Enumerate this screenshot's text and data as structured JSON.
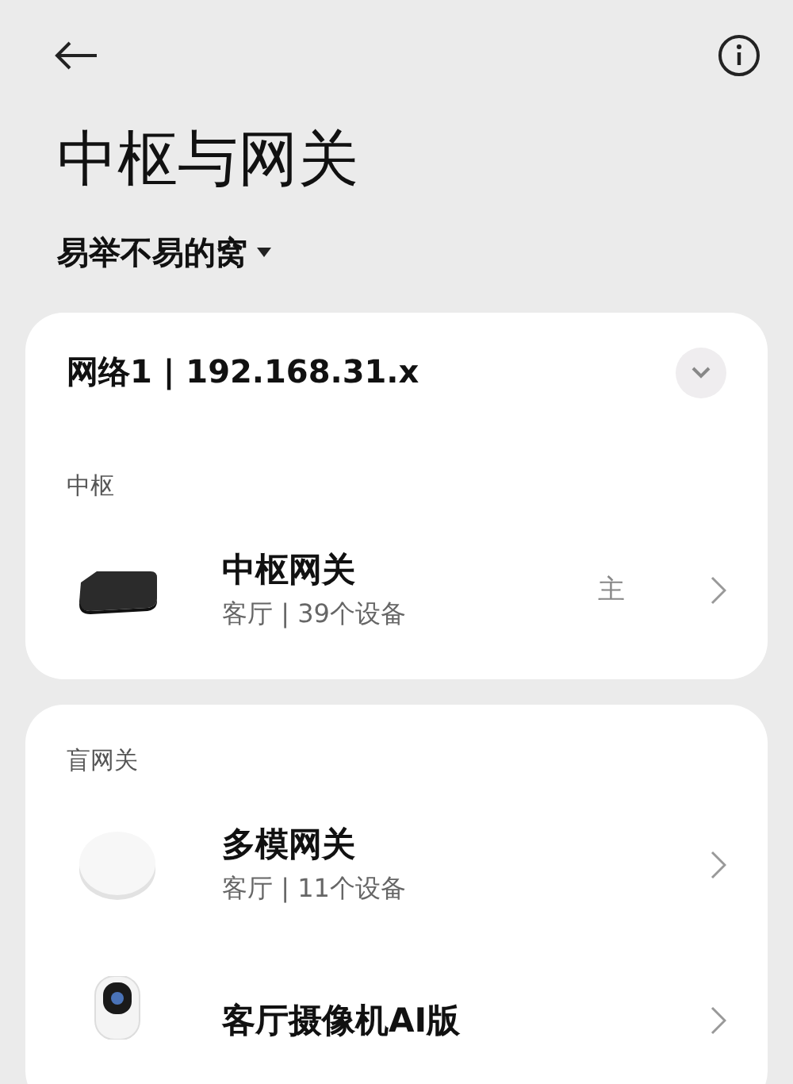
{
  "home": {
    "name": "易举不易的窝"
  },
  "title": "中枢与网关",
  "network": {
    "label": "网络1 | 192.168.31.x",
    "expanded": false
  },
  "sections": [
    {
      "label": "中枢",
      "devices": [
        {
          "kind": "hub",
          "name": "中枢网关",
          "subtitle": "客厅 | 39个设备",
          "badge": "主"
        }
      ]
    },
    {
      "label": "盲网关",
      "devices": [
        {
          "kind": "puck",
          "name": "多模网关",
          "subtitle": "客厅 | 11个设备"
        },
        {
          "kind": "camera",
          "name": "客厅摄像机AI版"
        }
      ]
    }
  ]
}
